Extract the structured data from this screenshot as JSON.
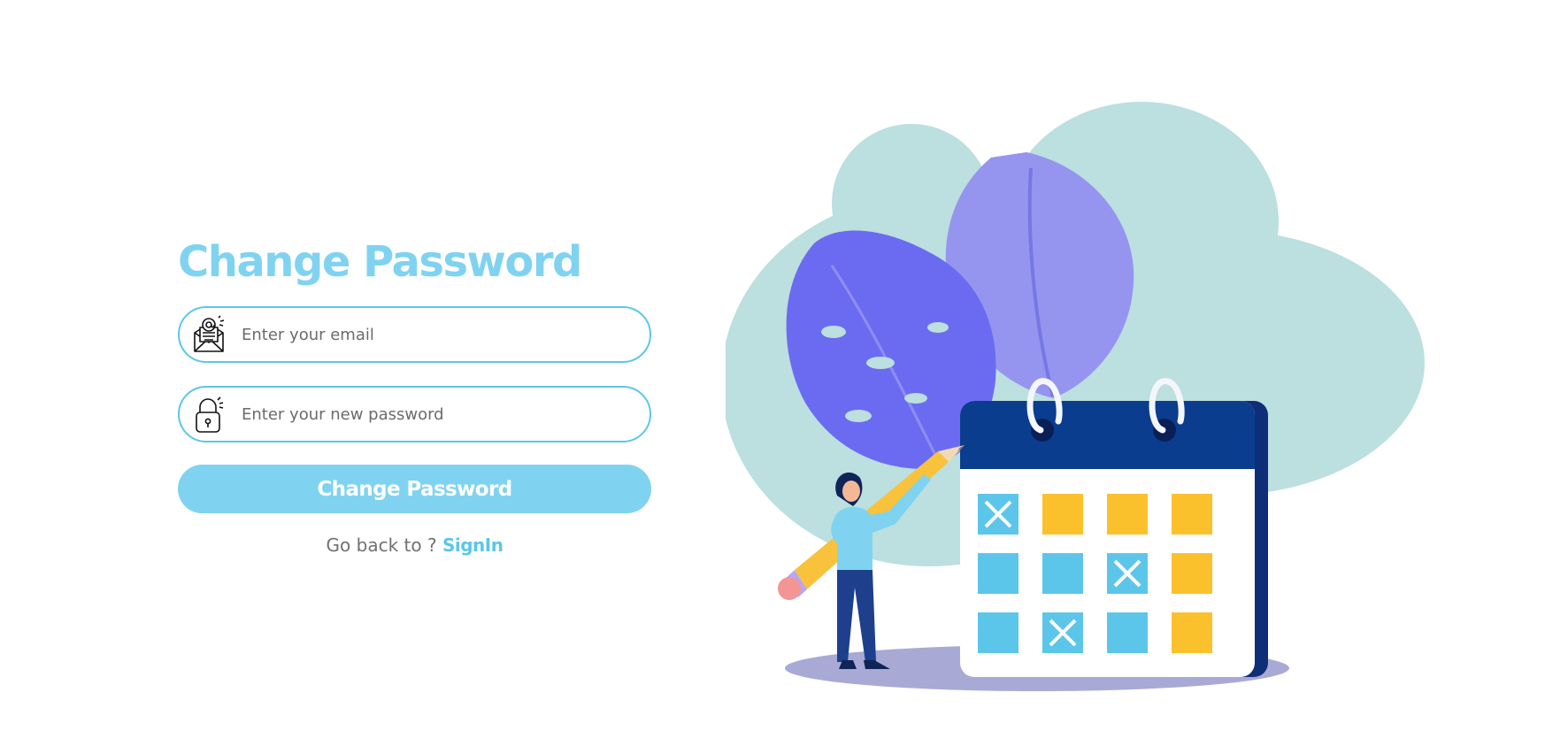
{
  "theme": {
    "accent": "#7fd3f0",
    "accent_dark": "#5cc6ea",
    "muted_text": "#707070"
  },
  "form": {
    "title": "Change Password",
    "email": {
      "placeholder": "Enter your email",
      "value": "",
      "icon": "email-at-icon"
    },
    "password": {
      "placeholder": "Enter your new password",
      "value": "",
      "icon": "padlock-icon"
    },
    "submit_label": "Change Password",
    "back_prompt": "Go back to ? ",
    "back_link": "SignIn"
  },
  "illustration": {
    "name": "calendar-scheduling-illustration",
    "calendar_cells": [
      "x",
      "y",
      "y",
      "y",
      "b",
      "b",
      "x",
      "y",
      "b",
      "x",
      "b",
      "y"
    ]
  }
}
